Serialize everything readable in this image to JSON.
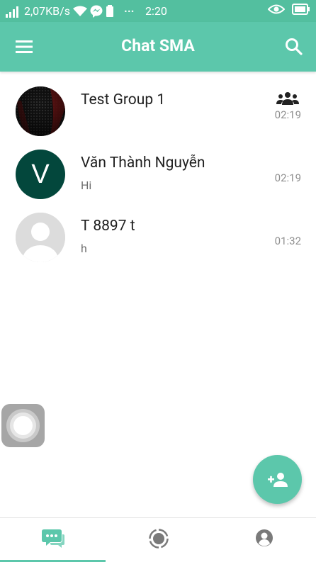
{
  "status_bar": {
    "network_speed": "2,07KB/s",
    "dots": "···",
    "time": "2:20",
    "icons": [
      "signal-icon",
      "wifi-icon",
      "messenger-icon",
      "battery-small-icon",
      "eye-icon",
      "battery-icon"
    ]
  },
  "app_bar": {
    "title": "Chat SMA",
    "menu_icon": "menu-icon",
    "search_icon": "search-icon"
  },
  "chats": [
    {
      "name": "Test Group 1",
      "message": "",
      "time": "02:19",
      "is_group": true,
      "avatar_type": "image"
    },
    {
      "name": "Văn Thành Nguyễn",
      "message": "Hi",
      "time": "02:19",
      "is_group": false,
      "avatar_type": "initial",
      "avatar_letter": "V",
      "avatar_color": "#03473c"
    },
    {
      "name": "T 8897 t",
      "message": "h",
      "time": "01:32",
      "is_group": false,
      "avatar_type": "placeholder"
    }
  ],
  "fab": {
    "icon": "add-person-icon"
  },
  "bottom_nav": {
    "tabs": [
      {
        "name": "chats",
        "icon": "chat-bubbles-icon",
        "active": true
      },
      {
        "name": "stories",
        "icon": "story-circle-icon",
        "active": false
      },
      {
        "name": "profile",
        "icon": "profile-icon",
        "active": false
      }
    ]
  },
  "colors": {
    "primary": "#5cc7ab",
    "status_bar": "#53bf9f",
    "avatar_v": "#03473c"
  }
}
